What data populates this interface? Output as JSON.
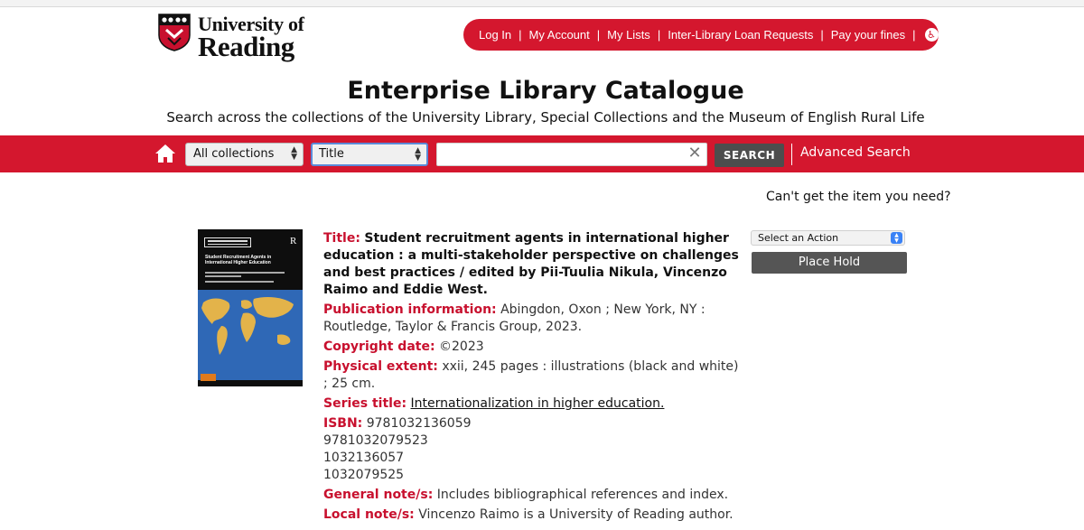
{
  "brand": {
    "name_line1": "University of",
    "name_line2": "Reading"
  },
  "top_nav": {
    "items": [
      {
        "label": "Log In"
      },
      {
        "label": "My Account"
      },
      {
        "label": "My Lists"
      },
      {
        "label": "Inter-Library Loan Requests"
      },
      {
        "label": "Pay your fines"
      }
    ],
    "accessibility_icon": "accessibility-icon"
  },
  "header": {
    "title": "Enterprise Library Catalogue",
    "subtitle": "Search across the collections of the University Library, Special Collections and the Museum of English Rural Life"
  },
  "search": {
    "collection_selected": "All collections",
    "field_selected": "Title",
    "query": "",
    "button_label": "SEARCH",
    "advanced_label": "Advanced Search"
  },
  "help_link": "Can't get the item you need?",
  "cover": {
    "title_line1": "Student Recruitment Agents in",
    "title_line2": "International Higher Education"
  },
  "record": {
    "title_label": "Title:",
    "title_value": "Student recruitment agents in international higher education : a multi-stakeholder perspective on challenges and best practices / edited by Pii-Tuulia Nikula, Vincenzo Raimo and Eddie West.",
    "publication_label": "Publication information:",
    "publication_value": "Abingdon, Oxon ; New York, NY : Routledge, Taylor & Francis Group, 2023.",
    "copyright_label": "Copyright date:",
    "copyright_value": "©2023",
    "extent_label": "Physical extent:",
    "extent_value": "xxii, 245 pages : illustrations (black and white) ; 25 cm.",
    "series_label": "Series title:",
    "series_value": "Internationalization in higher education.",
    "isbn_label": "ISBN:",
    "isbn_values": [
      "9781032136059",
      "9781032079523",
      "1032136057",
      "1032079525"
    ],
    "general_note_label": "General note/s:",
    "general_note_value": "Includes bibliographical references and index.",
    "local_note_label": "Local note/s:",
    "local_note_value": "Vincenzo Raimo is a University of Reading author."
  },
  "actions": {
    "select_label": "Select an Action",
    "place_hold_label": "Place Hold"
  },
  "colors": {
    "brand_red": "#d4172e",
    "label_red": "#c8102e",
    "button_grey": "#4d4d4d"
  }
}
